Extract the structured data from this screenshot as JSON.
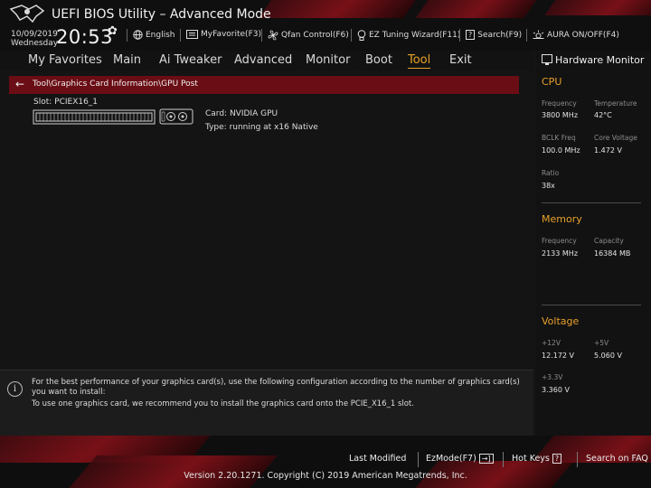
{
  "header": {
    "title": "UEFI BIOS Utility – Advanced Mode",
    "date": "10/09/2019",
    "weekday": "Wednesday",
    "time": "20:53",
    "toolbar": [
      {
        "label": "English",
        "icon": "globe-icon"
      },
      {
        "label": "MyFavorite(F3)",
        "icon": "favorite-icon"
      },
      {
        "label": "Qfan Control(F6)",
        "icon": "fan-icon"
      },
      {
        "label": "EZ Tuning Wizard(F11)",
        "icon": "bulb-icon"
      },
      {
        "label": "Search(F9)",
        "icon": "search-icon"
      },
      {
        "label": "AURA ON/OFF(F4)",
        "icon": "aura-icon"
      }
    ]
  },
  "nav": {
    "tabs": [
      "My Favorites",
      "Main",
      "Ai Tweaker",
      "Advanced",
      "Monitor",
      "Boot",
      "Tool",
      "Exit"
    ],
    "active": "Tool"
  },
  "breadcrumb": "Tool\\Graphics Card Information\\GPU Post",
  "gpu": {
    "slot": "Slot: PCIEX16_1",
    "card": "Card: NVIDIA GPU",
    "type": "Type: running at x16 Native"
  },
  "help": {
    "line1": "For the best performance of your graphics card(s), use the following configuration according to the number of graphics card(s) you want to install:",
    "line2": "To use one graphics card, we recommend you to install the graphics card onto the PCIE_X16_1 slot."
  },
  "hardware_monitor": {
    "title": "Hardware Monitor",
    "cpu": {
      "title": "CPU",
      "frequency_label": "Frequency",
      "frequency": "3800 MHz",
      "temperature_label": "Temperature",
      "temperature": "42°C",
      "bclk_label": "BCLK Freq",
      "bclk": "100.0 MHz",
      "core_voltage_label": "Core Voltage",
      "core_voltage": "1.472 V",
      "ratio_label": "Ratio",
      "ratio": "38x"
    },
    "memory": {
      "title": "Memory",
      "frequency_label": "Frequency",
      "frequency": "2133 MHz",
      "capacity_label": "Capacity",
      "capacity": "16384 MB"
    },
    "voltage": {
      "title": "Voltage",
      "v12_label": "+12V",
      "v12": "12.172 V",
      "v5_label": "+5V",
      "v5": "5.060 V",
      "v33_label": "+3.3V",
      "v33": "3.360 V"
    }
  },
  "footer": {
    "last_modified": "Last Modified",
    "ezmode": "EzMode(F7)",
    "hotkeys": "Hot Keys",
    "search_faq": "Search on FAQ",
    "copyright": "Version 2.20.1271. Copyright (C) 2019 American Megatrends, Inc."
  },
  "colors": {
    "accent": "#e7a12a",
    "brand_red": "#8a1119",
    "breadcrumb_bg": "#6a0d14"
  }
}
